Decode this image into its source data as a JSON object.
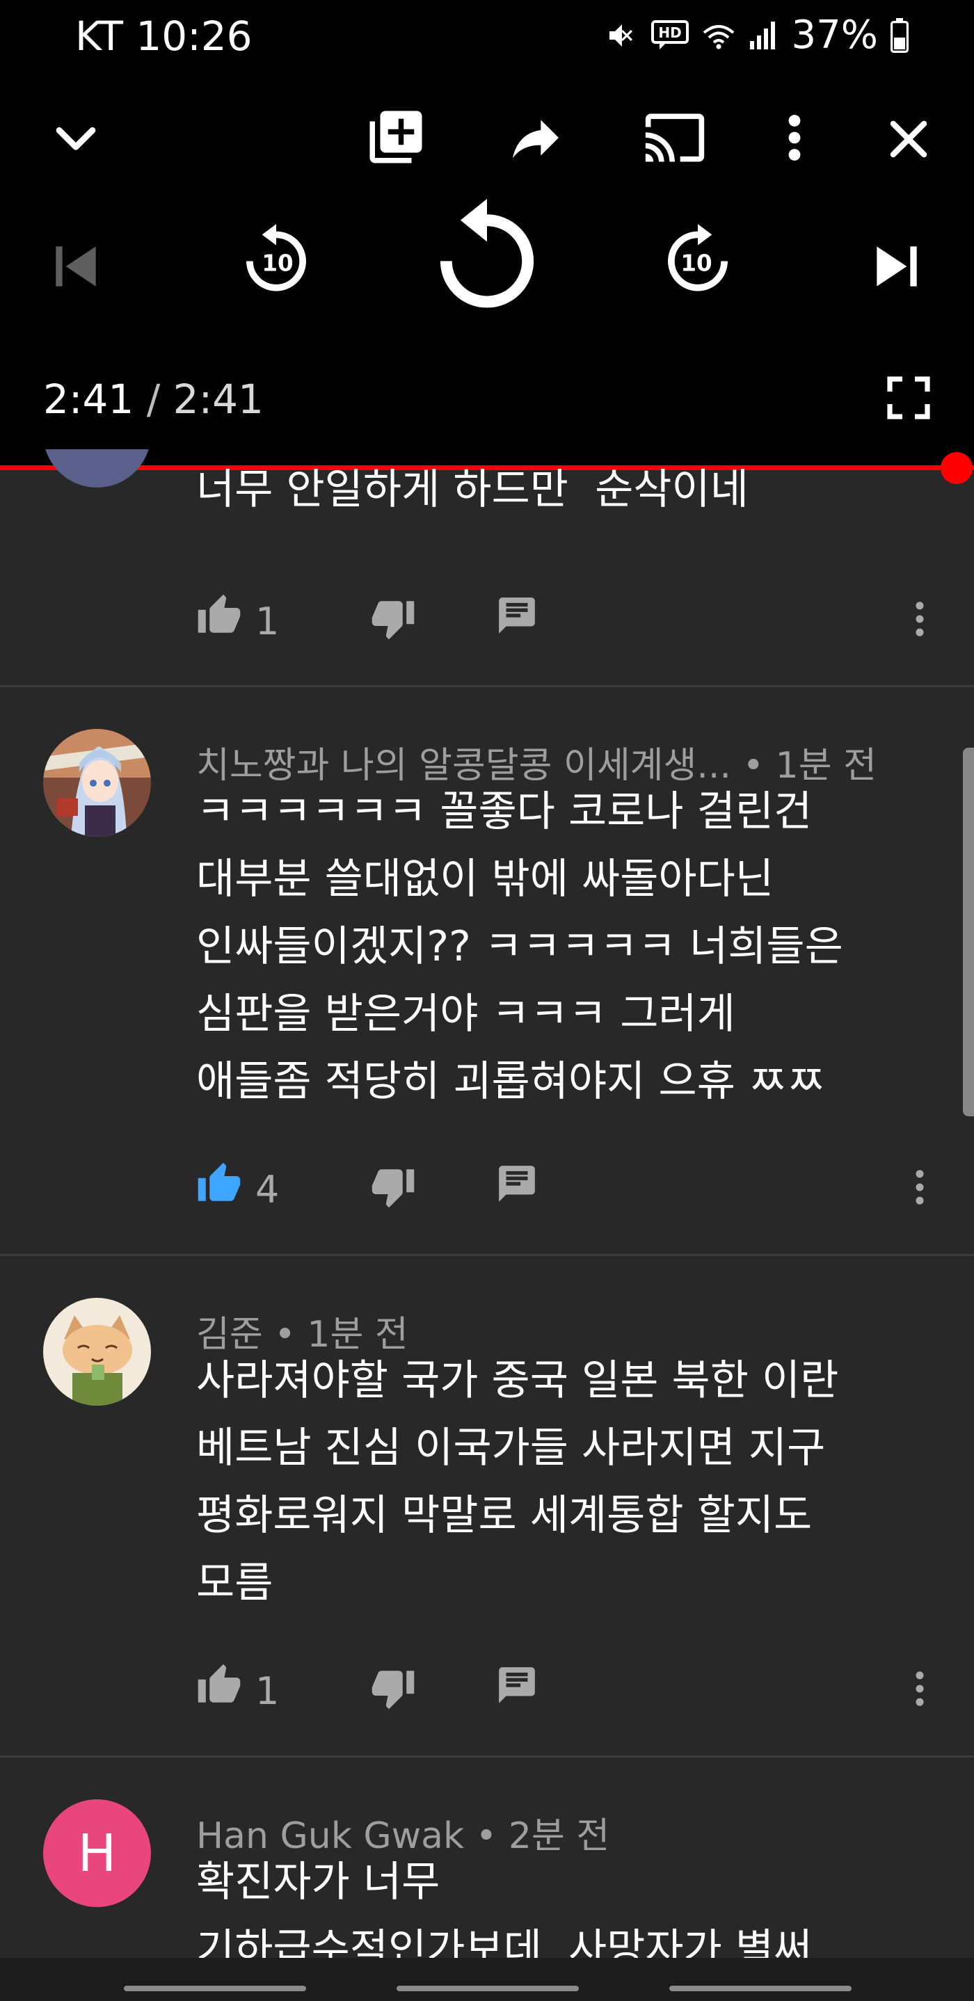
{
  "status_bar": {
    "carrier_time": "KT 10:26",
    "battery": "37%"
  },
  "player": {
    "current_time": "2:41",
    "separator": "/",
    "duration": "2:41",
    "skip_back_seconds": "10",
    "skip_forward_seconds": "10",
    "progress_fraction": 1.0
  },
  "comments": [
    {
      "author_meta": "",
      "text": "너무 안일하게 하드만  순삭이네",
      "likes": "1",
      "liked": false
    },
    {
      "author_meta": "치노짱과 나의 알콩달콩 이세계생... • 1분 전",
      "text": "ㅋㅋㅋㅋㅋㅋ 꼴좋다 코로나 걸린건\n대부분 쓸대없이 밖에 싸돌아다닌\n인싸들이겠지?? ㅋㅋㅋㅋㅋ 너희들은\n심판을 받은거야 ㅋㅋㅋ 그러게\n애들좀 적당히 괴롭혀야지 으휴 ㅉㅉ",
      "likes": "4",
      "liked": true
    },
    {
      "author_meta": "김준 • 1분 전",
      "text": "사라져야할 국가 중국 일본 북한 이란\n베트남 진심 이국가들 사라지면 지구\n평화로워지 막말로 세계통합 할지도\n모름",
      "likes": "1",
      "liked": false
    },
    {
      "author_meta": "Han Guk Gwak • 2분 전",
      "avatar_letter": "H",
      "text": "확진자가 너무\n기하급수적인가보데  사망자가 별써",
      "likes": "",
      "liked": false
    }
  ],
  "colors": {
    "progress": "#ff0000",
    "liked_thumb": "#3ea6ff",
    "avatar_h": "#e8467c"
  }
}
